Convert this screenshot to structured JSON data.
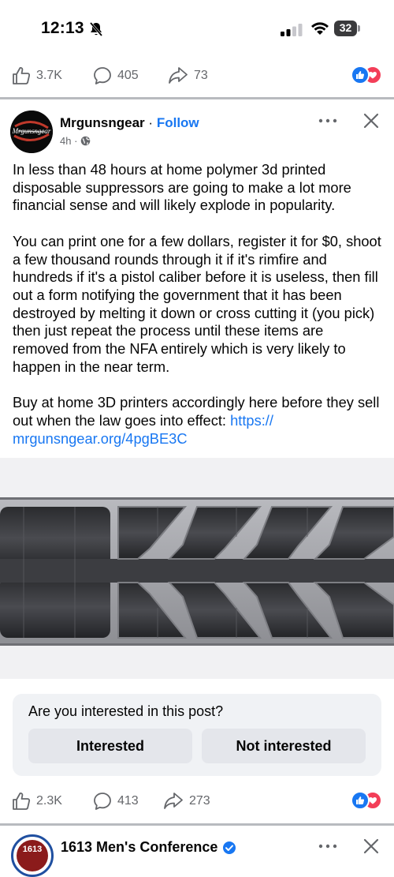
{
  "status_bar": {
    "time": "12:13",
    "battery": "32"
  },
  "top_reactions": {
    "likes": "3.7K",
    "comments": "405",
    "shares": "73"
  },
  "post": {
    "author": "Mrgunsngear",
    "separator": "·",
    "follow_label": "Follow",
    "time": "4h ·",
    "avatar_text": "Mrgunsngear",
    "paragraph_1": "In less than 48 hours at home polymer 3d printed disposable suppressors are going to make a lot more financial sense and will likely explode in popularity.",
    "paragraph_2": "You can print one for a few dollars, register it for $0, shoot a few thousand rounds through it if it's rimfire and hundreds if it's a pistol caliber before it is useless, then fill out a form notifying the government that it has been destroyed by melting it down or cross cutting it (you pick) then just repeat the process until these items are removed from the NFA entirely which is very likely to happen in the near term.",
    "paragraph_3": "Buy at home 3D printers accordingly here before they sell out when the law goes into effect: ",
    "link_text": "https://\nmrgunsngear.org/4pgBE3C"
  },
  "survey": {
    "question": "Are you interested in this post?",
    "interested_label": "Interested",
    "not_interested_label": "Not interested"
  },
  "bottom_reactions": {
    "likes": "2.3K",
    "comments": "413",
    "shares": "273"
  },
  "next_post": {
    "author": "1613 Men's Conference",
    "avatar_text": "1613"
  },
  "colors": {
    "accent": "#1877f2",
    "secondary_text": "#65676b",
    "survey_bg": "#f0f2f5"
  }
}
